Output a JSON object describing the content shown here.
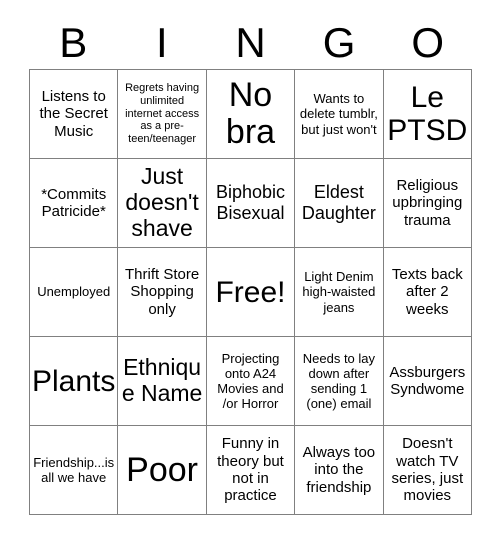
{
  "header": {
    "letters": [
      "B",
      "I",
      "N",
      "G",
      "O"
    ]
  },
  "grid": {
    "columns": 5,
    "rows": 5,
    "border_color": "#808080",
    "background_color": "#ffffff",
    "text_color": "#000000",
    "cells": [
      {
        "text": "Listens to the Secret Music",
        "size": "md"
      },
      {
        "text": "Regrets having unlimited internet access as a pre-teen/teenager",
        "size": "xs"
      },
      {
        "text": "No bra",
        "size": "3xl"
      },
      {
        "text": "Wants to delete tumblr, but just won't",
        "size": "sm"
      },
      {
        "text": "Le PTSD",
        "size": "2xl"
      },
      {
        "text": "*Commits Patricide*",
        "size": "md"
      },
      {
        "text": "Just doesn't shave",
        "size": "xl"
      },
      {
        "text": "Biphobic Bisexual",
        "size": "lg"
      },
      {
        "text": "Eldest Daughter",
        "size": "lg"
      },
      {
        "text": "Religious upbringing trauma",
        "size": "md"
      },
      {
        "text": "Unemployed",
        "size": "sm"
      },
      {
        "text": "Thrift Store Shopping only",
        "size": "md"
      },
      {
        "text": "Free!",
        "size": "2xl"
      },
      {
        "text": "Light Denim high-waisted jeans",
        "size": "sm"
      },
      {
        "text": "Texts back after 2 weeks",
        "size": "md"
      },
      {
        "text": "Plants",
        "size": "2xl"
      },
      {
        "text": "Ethnique Name",
        "size": "xl"
      },
      {
        "text": "Projecting onto A24 Movies and /or Horror",
        "size": "sm"
      },
      {
        "text": "Needs to lay down after sending 1 (one) email",
        "size": "sm"
      },
      {
        "text": "Assburgers Syndwome",
        "size": "md"
      },
      {
        "text": "Friendship...is all we have",
        "size": "sm"
      },
      {
        "text": "Poor",
        "size": "3xl"
      },
      {
        "text": "Funny in theory but not in practice",
        "size": "md"
      },
      {
        "text": "Always too into the friendship",
        "size": "md"
      },
      {
        "text": "Doesn't watch TV series, just movies",
        "size": "md"
      }
    ]
  }
}
